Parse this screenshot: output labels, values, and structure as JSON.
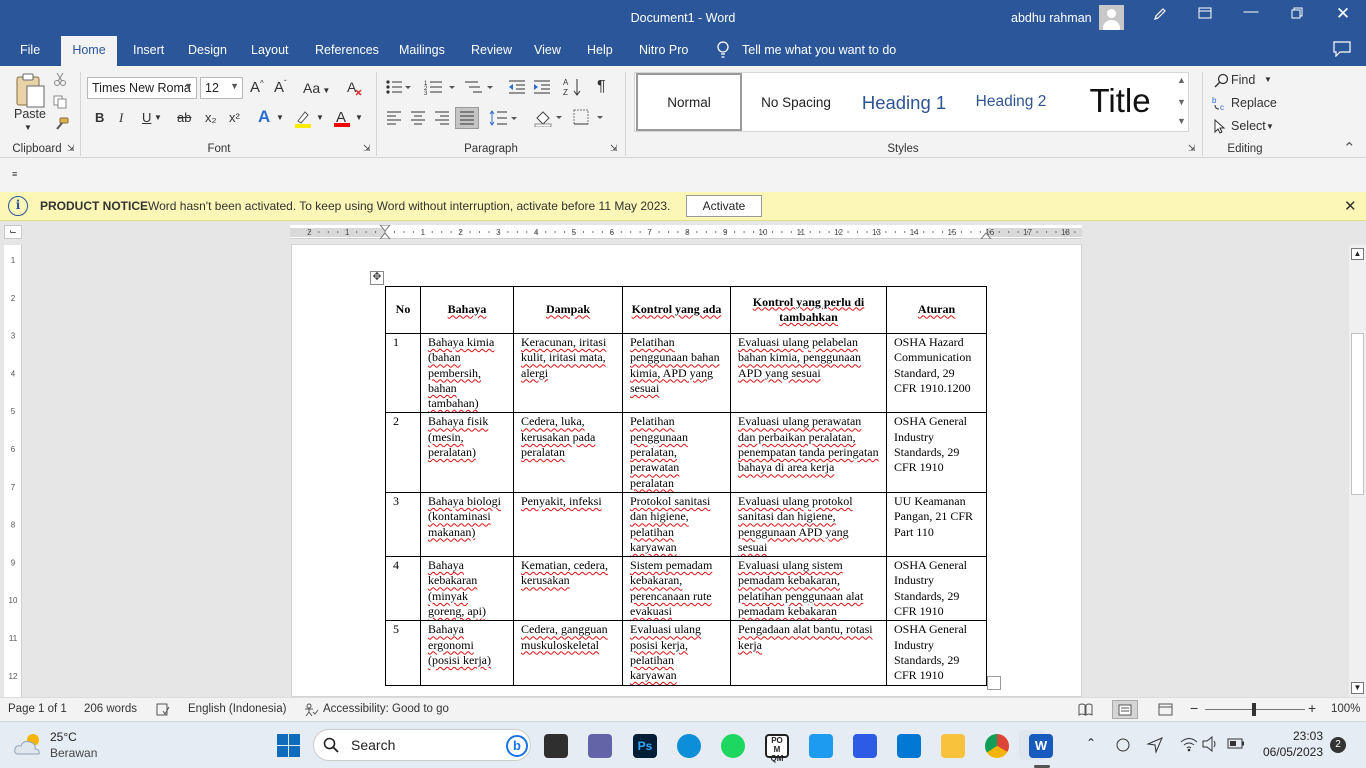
{
  "window": {
    "title": "Document1  -  Word",
    "user": "abdhu rahman"
  },
  "tabs": [
    "File",
    "Home",
    "Insert",
    "Design",
    "Layout",
    "References",
    "Mailings",
    "Review",
    "View",
    "Help",
    "Nitro Pro"
  ],
  "tell_me": "Tell me what you want to do",
  "ribbon": {
    "paste_label": "Paste",
    "font_name": "Times New Roma",
    "font_size": "12",
    "groups": {
      "clipboard": "Clipboard",
      "font": "Font",
      "paragraph": "Paragraph",
      "styles": "Styles",
      "editing": "Editing"
    },
    "styles": [
      "Normal",
      "No Spacing",
      "Heading 1",
      "Heading 2",
      "Title"
    ],
    "editing": {
      "find": "Find",
      "replace": "Replace",
      "select": "Select"
    },
    "font_buttons": {
      "bold": "B",
      "italic": "I",
      "underline": "U",
      "strike": "ab",
      "subscript": "x₂",
      "superscript": "x²"
    },
    "case_button": "Aa",
    "pilcrow": "¶"
  },
  "notice": {
    "label": "PRODUCT NOTICE",
    "text": "Word hasn't been activated. To keep using Word without interruption, activate before 11 May 2023.",
    "button": "Activate"
  },
  "ruler": {
    "ticks": [
      "2",
      "1",
      "1",
      "2",
      "3",
      "4",
      "5",
      "6",
      "7",
      "8",
      "9",
      "10",
      "11",
      "12",
      "13",
      "14",
      "15",
      "16",
      "17",
      "18"
    ]
  },
  "table": {
    "headers": [
      "No",
      "Bahaya",
      "Dampak",
      "Kontrol yang ada",
      "Kontrol yang perlu di tambahkan",
      "Aturan"
    ],
    "rows": [
      [
        "1",
        "Bahaya kimia (bahan pembersih, bahan tambahan)",
        "Keracunan, iritasi kulit, iritasi mata, alergi",
        "Pelatihan penggunaan bahan kimia, APD yang sesuai",
        "Evaluasi ulang pelabelan bahan kimia, penggunaan APD yang sesuai",
        "OSHA Hazard Communication Standard, 29 CFR 1910.1200"
      ],
      [
        "2",
        "Bahaya fisik (mesin, peralatan)",
        "Cedera, luka, kerusakan pada peralatan",
        "Pelatihan penggunaan peralatan, perawatan peralatan",
        "Evaluasi ulang perawatan dan perbaikan peralatan, penempatan tanda peringatan bahaya di area kerja",
        "OSHA General Industry Standards, 29 CFR 1910"
      ],
      [
        "3",
        "Bahaya biologi (kontaminasi makanan)",
        "Penyakit, infeksi",
        "Protokol sanitasi dan higiene, pelatihan karyawan",
        "Evaluasi ulang protokol sanitasi dan higiene, penggunaan APD yang sesuai",
        "UU Keamanan Pangan, 21 CFR Part 110"
      ],
      [
        "4",
        "Bahaya kebakaran (minyak goreng, api)",
        "Kematian, cedera, kerusakan",
        "Sistem pemadam kebakaran, perencanaan rute evakuasi",
        "Evaluasi ulang sistem pemadam kebakaran, pelatihan penggunaan alat pemadam kebakaran",
        "OSHA General Industry Standards, 29 CFR 1910"
      ],
      [
        "5",
        "Bahaya ergonomi (posisi kerja)",
        "Cedera, gangguan muskuloskeletal",
        "Evaluasi ulang posisi kerja, pelatihan karyawan",
        "Pengadaan alat bantu, rotasi kerja",
        "OSHA General Industry Standards, 29 CFR 1910"
      ]
    ]
  },
  "status": {
    "page": "Page 1 of 1",
    "words": "206 words",
    "language": "English (Indonesia)",
    "accessibility": "Accessibility: Good to go",
    "zoom": "100%"
  },
  "taskbar": {
    "temp": "25°C",
    "weather": "Berawan",
    "search": "Search",
    "time": "23:03",
    "date": "06/05/2023",
    "notifications": "2"
  },
  "colors": {
    "word_blue": "#2b579a",
    "notice_bg": "#fcf7b6"
  }
}
